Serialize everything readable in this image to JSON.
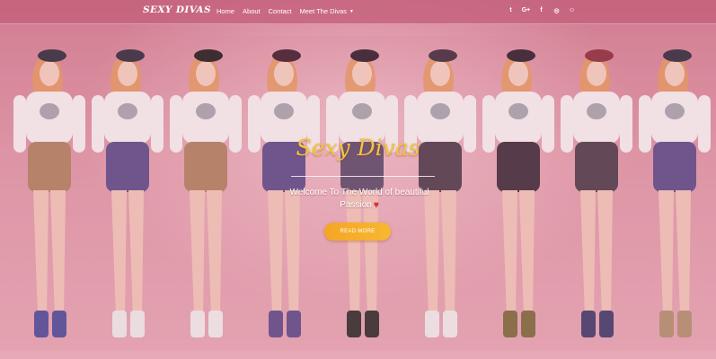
{
  "site": {
    "brand": "SEXY DIVAS"
  },
  "nav": {
    "links": [
      {
        "label": "Home"
      },
      {
        "label": "About"
      },
      {
        "label": "Contact"
      },
      {
        "label": "Meet The Divas",
        "caret": "▼"
      }
    ]
  },
  "social": {
    "icons": [
      {
        "name": "twitter-icon",
        "glyph": "t"
      },
      {
        "name": "google-plus-icon",
        "glyph": "G+"
      },
      {
        "name": "facebook-icon",
        "glyph": "f"
      },
      {
        "name": "instagram-icon",
        "glyph": "◎"
      },
      {
        "name": "snapchat-icon",
        "glyph": "☺"
      }
    ]
  },
  "hero": {
    "title": "Sexy Divas",
    "subtitle": "Welcome To The World of beautiful Passion",
    "heart": "♥",
    "button": "READ MORE",
    "figures": [
      {
        "shorts": "#b08060",
        "shoes": "#4a4a9a",
        "hat": "#2a2a3a"
      },
      {
        "shorts": "#5a4a8a",
        "shoes": "#eeeeee",
        "hat": "#2a2a3a"
      },
      {
        "shorts": "#b08060",
        "shoes": "#f0f0f0",
        "hat": "#1a1a1a"
      },
      {
        "shorts": "#5a4a8a",
        "shoes": "#5a4a8a",
        "hat": "#3a1a2a"
      },
      {
        "shorts": "#5a4a6a",
        "shoes": "#2a2a2a",
        "hat": "#2a1a2a"
      },
      {
        "shorts": "#4a3a4a",
        "shoes": "#f0f0f0",
        "hat": "#3a2a3a"
      },
      {
        "shorts": "#3a2a3a",
        "shoes": "#7a6a3a",
        "hat": "#2a1a2a"
      },
      {
        "shorts": "#4a3a4a",
        "shoes": "#3a3a6a",
        "hat": "#8a2a3a"
      },
      {
        "shorts": "#5a4a8a",
        "shoes": "#b09070",
        "hat": "#2a2a3a"
      }
    ]
  }
}
